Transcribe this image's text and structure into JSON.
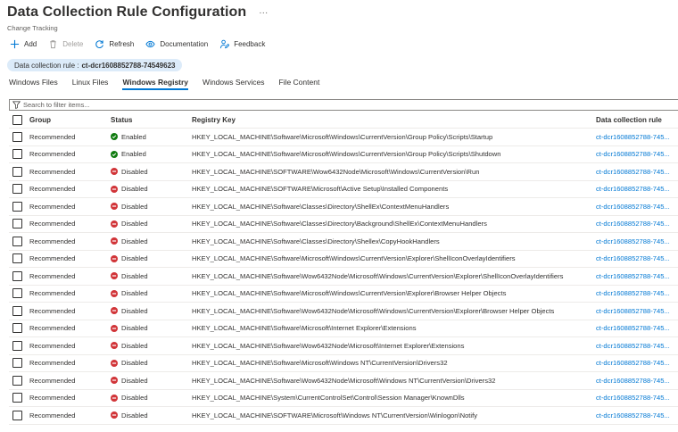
{
  "header": {
    "title": "Data Collection Rule Configuration",
    "more": "···",
    "subtitle": "Change Tracking"
  },
  "toolbar": {
    "add": "Add",
    "delete": "Delete",
    "refresh": "Refresh",
    "documentation": "Documentation",
    "feedback": "Feedback"
  },
  "rule_pill": {
    "label": "Data collection rule :",
    "value": "ct-dcr1608852788-74549623"
  },
  "tabs": [
    {
      "label": "Windows Files",
      "active": false
    },
    {
      "label": "Linux Files",
      "active": false
    },
    {
      "label": "Windows Registry",
      "active": true
    },
    {
      "label": "Windows Services",
      "active": false
    },
    {
      "label": "File Content",
      "active": false
    }
  ],
  "search": {
    "placeholder": "Search to filter items..."
  },
  "columns": {
    "group": "Group",
    "status": "Status",
    "key": "Registry Key",
    "rule": "Data collection rule"
  },
  "colors": {
    "accent": "#0078d4",
    "enabled": "#107c10",
    "disabled": "#d13438"
  },
  "rows": [
    {
      "group": "Recommended",
      "status": "Enabled",
      "key": "HKEY_LOCAL_MACHINE\\Software\\Microsoft\\Windows\\CurrentVersion\\Group Policy\\Scripts\\Startup",
      "rule": "ct-dcr1608852788-745..."
    },
    {
      "group": "Recommended",
      "status": "Enabled",
      "key": "HKEY_LOCAL_MACHINE\\Software\\Microsoft\\Windows\\CurrentVersion\\Group Policy\\Scripts\\Shutdown",
      "rule": "ct-dcr1608852788-745..."
    },
    {
      "group": "Recommended",
      "status": "Disabled",
      "key": "HKEY_LOCAL_MACHINE\\SOFTWARE\\Wow6432Node\\Microsoft\\Windows\\CurrentVersion\\Run",
      "rule": "ct-dcr1608852788-745..."
    },
    {
      "group": "Recommended",
      "status": "Disabled",
      "key": "HKEY_LOCAL_MACHINE\\SOFTWARE\\Microsoft\\Active Setup\\Installed Components",
      "rule": "ct-dcr1608852788-745..."
    },
    {
      "group": "Recommended",
      "status": "Disabled",
      "key": "HKEY_LOCAL_MACHINE\\Software\\Classes\\Directory\\ShellEx\\ContextMenuHandlers",
      "rule": "ct-dcr1608852788-745..."
    },
    {
      "group": "Recommended",
      "status": "Disabled",
      "key": "HKEY_LOCAL_MACHINE\\Software\\Classes\\Directory\\Background\\ShellEx\\ContextMenuHandlers",
      "rule": "ct-dcr1608852788-745..."
    },
    {
      "group": "Recommended",
      "status": "Disabled",
      "key": "HKEY_LOCAL_MACHINE\\Software\\Classes\\Directory\\Shellex\\CopyHookHandlers",
      "rule": "ct-dcr1608852788-745..."
    },
    {
      "group": "Recommended",
      "status": "Disabled",
      "key": "HKEY_LOCAL_MACHINE\\Software\\Microsoft\\Windows\\CurrentVersion\\Explorer\\ShellIconOverlayIdentifiers",
      "rule": "ct-dcr1608852788-745..."
    },
    {
      "group": "Recommended",
      "status": "Disabled",
      "key": "HKEY_LOCAL_MACHINE\\Software\\Wow6432Node\\Microsoft\\Windows\\CurrentVersion\\Explorer\\ShellIconOverlayIdentifiers",
      "rule": "ct-dcr1608852788-745..."
    },
    {
      "group": "Recommended",
      "status": "Disabled",
      "key": "HKEY_LOCAL_MACHINE\\Software\\Microsoft\\Windows\\CurrentVersion\\Explorer\\Browser Helper Objects",
      "rule": "ct-dcr1608852788-745..."
    },
    {
      "group": "Recommended",
      "status": "Disabled",
      "key": "HKEY_LOCAL_MACHINE\\Software\\Wow6432Node\\Microsoft\\Windows\\CurrentVersion\\Explorer\\Browser Helper Objects",
      "rule": "ct-dcr1608852788-745..."
    },
    {
      "group": "Recommended",
      "status": "Disabled",
      "key": "HKEY_LOCAL_MACHINE\\Software\\Microsoft\\Internet Explorer\\Extensions",
      "rule": "ct-dcr1608852788-745..."
    },
    {
      "group": "Recommended",
      "status": "Disabled",
      "key": "HKEY_LOCAL_MACHINE\\Software\\Wow6432Node\\Microsoft\\Internet Explorer\\Extensions",
      "rule": "ct-dcr1608852788-745..."
    },
    {
      "group": "Recommended",
      "status": "Disabled",
      "key": "HKEY_LOCAL_MACHINE\\Software\\Microsoft\\Windows NT\\CurrentVersion\\Drivers32",
      "rule": "ct-dcr1608852788-745..."
    },
    {
      "group": "Recommended",
      "status": "Disabled",
      "key": "HKEY_LOCAL_MACHINE\\Software\\Wow6432Node\\Microsoft\\Windows NT\\CurrentVersion\\Drivers32",
      "rule": "ct-dcr1608852788-745..."
    },
    {
      "group": "Recommended",
      "status": "Disabled",
      "key": "HKEY_LOCAL_MACHINE\\System\\CurrentControlSet\\Control\\Session Manager\\KnownDlls",
      "rule": "ct-dcr1608852788-745..."
    },
    {
      "group": "Recommended",
      "status": "Disabled",
      "key": "HKEY_LOCAL_MACHINE\\SOFTWARE\\Microsoft\\Windows NT\\CurrentVersion\\Winlogon\\Notify",
      "rule": "ct-dcr1608852788-745..."
    }
  ]
}
